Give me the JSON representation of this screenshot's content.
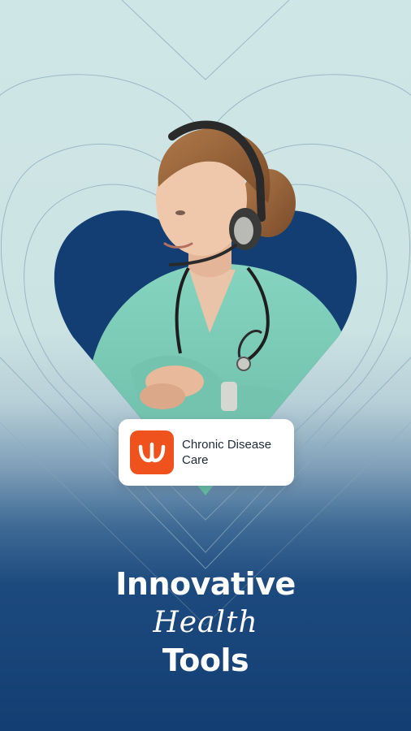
{
  "app_card": {
    "app_name": "Chronic Disease Care",
    "logo_icon": "app-logo-w-icon",
    "logo_color": "#f0521d"
  },
  "headline": {
    "line1": "Innovative",
    "line2": "Health",
    "line3": "Tools"
  },
  "theme": {
    "heart_fill": "#123e73",
    "scrub_color": "#79cdb6",
    "background_top": "#cfe6e6",
    "background_bottom": "#123e73"
  }
}
